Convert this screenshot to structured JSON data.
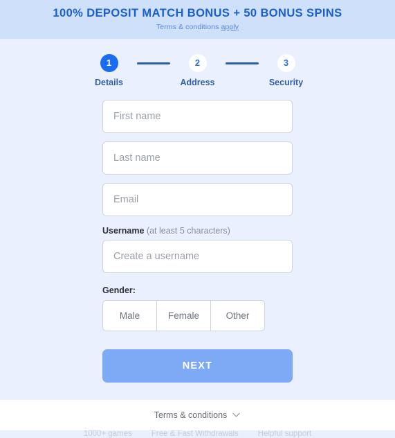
{
  "banner": {
    "title": "100% DEPOSIT MATCH BONUS + 50 BONUS SPINS",
    "subtitle_prefix": "Terms & conditions ",
    "subtitle_underlined": "apply"
  },
  "stepper": {
    "steps": [
      {
        "number": "1",
        "label": "Details",
        "state": "active"
      },
      {
        "number": "2",
        "label": "Address",
        "state": "inactive"
      },
      {
        "number": "3",
        "label": "Security",
        "state": "inactive"
      }
    ]
  },
  "form": {
    "first_name": {
      "placeholder": "First name",
      "value": ""
    },
    "last_name": {
      "placeholder": "Last name",
      "value": ""
    },
    "email": {
      "placeholder": "Email",
      "value": ""
    },
    "username": {
      "label": "Username",
      "hint": "(at least 5 characters)",
      "placeholder": "Create a username",
      "value": ""
    },
    "gender": {
      "label": "Gender:",
      "options": [
        "Male",
        "Female",
        "Other"
      ]
    },
    "next_label": "NEXT"
  },
  "badges": [
    {
      "icon": "slot-machine-icon",
      "label": "1000+ games"
    },
    {
      "icon": "stopwatch-icon",
      "label": "Free & Fast Withdrawals"
    },
    {
      "icon": "chat-support-icon",
      "label": "Helpful support"
    }
  ],
  "footer": {
    "terms_label": "Terms & conditions",
    "chevron_icon": "chevron-down-icon"
  },
  "colors": {
    "banner_bg": "#cfe0fb",
    "page_bg": "#eaf0fd",
    "brand_blue": "#1a5fd0",
    "step_active": "#1a6cf0",
    "next_button": "#7ea9f5",
    "badge_text": "#c2ccdf"
  }
}
